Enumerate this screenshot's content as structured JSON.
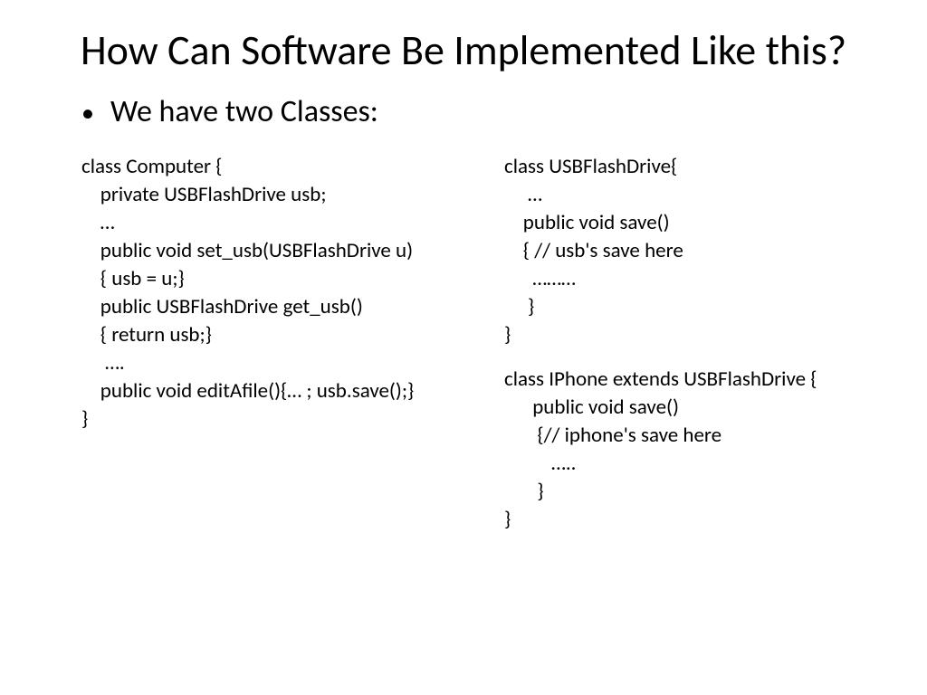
{
  "title": "How Can Software Be Implemented Like this?",
  "bullet": "We have two Classes:",
  "leftCode": "class Computer {\n    private USBFlashDrive usb;\n    …\n    public void set_usb(USBFlashDrive u)\n    { usb = u;}\n    public USBFlashDrive get_usb()\n    { return usb;}\n     ….\n    public void editAfile(){… ; usb.save();}\n}",
  "rightCode1": "class USBFlashDrive{\n     …\n    public void save()\n    { // usb's save here\n      ………\n     }\n}",
  "rightCode2": "class IPhone extends USBFlashDrive {\n      public void save()\n       {// iphone's save here\n          …..\n       }\n}"
}
